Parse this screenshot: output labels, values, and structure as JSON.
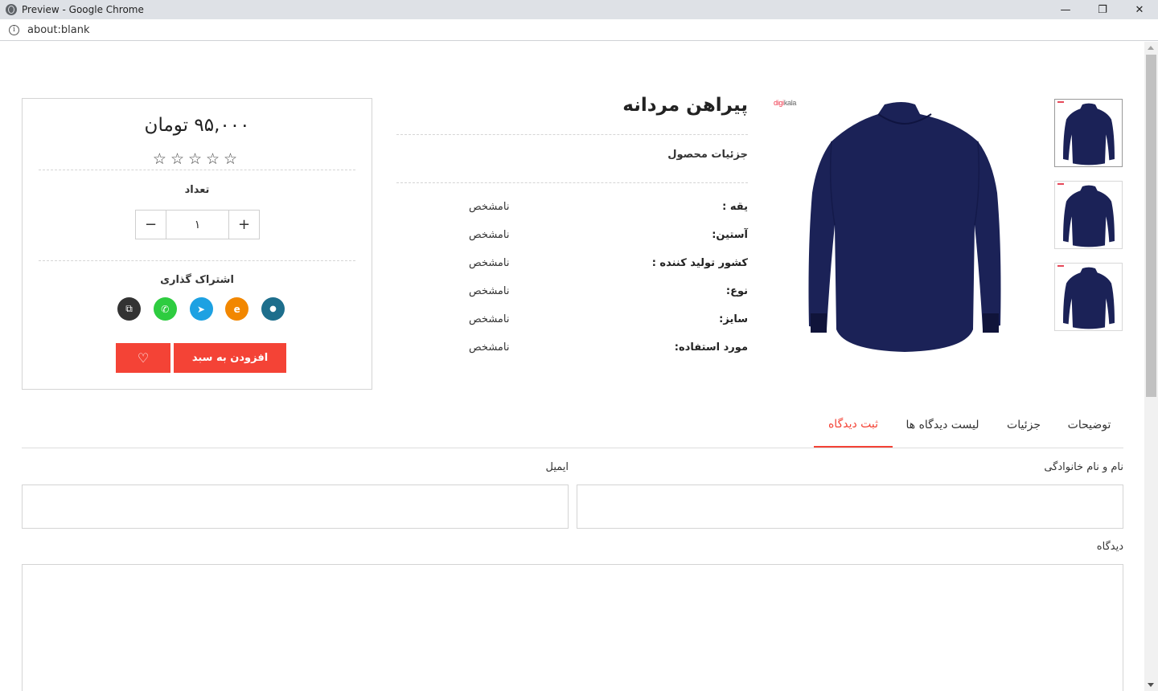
{
  "browser": {
    "window_title": "Preview - Google Chrome",
    "url": "about:blank",
    "controls": {
      "minimize": "—",
      "restore": "❐",
      "close": "✕"
    }
  },
  "product": {
    "title": "پیراهن مردانه",
    "details_heading": "جزئیات محصول",
    "brand_logo": {
      "part1": "digi",
      "part2": "kala"
    },
    "colors": {
      "shirt": "#1b2257",
      "accent": "#f44336"
    },
    "specs": [
      {
        "key": "یقه :",
        "value": "نامشخص"
      },
      {
        "key": "آستین:",
        "value": "نامشخص"
      },
      {
        "key": "کشور تولید کننده :",
        "value": "نامشخص"
      },
      {
        "key": "نوع:",
        "value": "نامشخص"
      },
      {
        "key": "سایز:",
        "value": "نامشخص"
      },
      {
        "key": "مورد استفاده:",
        "value": "نامشخص"
      }
    ]
  },
  "buybox": {
    "price": "۹۵,۰۰۰ تومان",
    "stars": "☆☆☆☆☆",
    "rating": 0,
    "quantity_label": "تعداد",
    "quantity_value": "۱",
    "minus": "−",
    "plus": "+",
    "share_label": "اشتراک گذاری",
    "share_buttons": [
      {
        "name": "copy-link",
        "icon": "copy-icon",
        "color": "#333333",
        "glyph": "⧉"
      },
      {
        "name": "whatsapp",
        "icon": "whatsapp-icon",
        "color": "#2ecc40",
        "glyph": "✆"
      },
      {
        "name": "telegram",
        "icon": "telegram-icon",
        "color": "#1da1e2",
        "glyph": "➤"
      },
      {
        "name": "eitaa",
        "icon": "eitaa-icon",
        "color": "#f28700",
        "glyph": "e"
      },
      {
        "name": "soroush",
        "icon": "soroush-icon",
        "color": "#1d6e8c",
        "glyph": "●"
      }
    ],
    "wishlist_glyph": "♡",
    "add_to_cart": "افزودن به سبد"
  },
  "tabs": [
    {
      "label": "توضیحات",
      "active": false
    },
    {
      "label": "جزئیات",
      "active": false
    },
    {
      "label": "لیست دیدگاه ها",
      "active": false
    },
    {
      "label": "ثبت دیدگاه",
      "active": true
    }
  ],
  "comment_form": {
    "name_label": "نام و نام خانوادگی",
    "name_value": "",
    "email_label": "ایمیل",
    "email_value": "",
    "comment_label": "دیدگاه",
    "comment_value": ""
  }
}
